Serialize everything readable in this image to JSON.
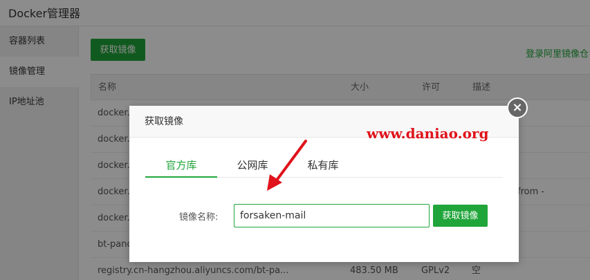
{
  "app": {
    "title": "Docker管理器"
  },
  "sidebar": {
    "items": [
      {
        "label": "容器列表"
      },
      {
        "label": "镜像管理"
      },
      {
        "label": "IP地址池"
      }
    ]
  },
  "toolbar": {
    "fetch_image_label": "获取镜像",
    "aliyun_login_link": "登录阿里镜像仓"
  },
  "table": {
    "headers": {
      "name": "名称",
      "size": "大小",
      "license": "许可",
      "desc": "描述"
    },
    "rows": [
      {
        "name": "docker.",
        "size": "",
        "license": "",
        "desc": ""
      },
      {
        "name": "docker.",
        "size": "",
        "license": "",
        "desc": ""
      },
      {
        "name": "docker.",
        "size": "",
        "license": "",
        "desc": ""
      },
      {
        "name": "docker.",
        "size": "",
        "license": "",
        "desc": "from -"
      },
      {
        "name": "docker.",
        "size": "",
        "license": "",
        "desc": ""
      },
      {
        "name": "bt-panc",
        "size": "",
        "license": "",
        "desc": ""
      },
      {
        "name": "registry.cn-hangzhou.aliyuncs.com/bt-pa...",
        "size": "483.50 MB",
        "license": "GPLv2",
        "desc": "空"
      }
    ]
  },
  "dialog": {
    "title": "获取镜像",
    "close_symbol": "×",
    "tabs": [
      {
        "label": "官方库"
      },
      {
        "label": "公网库"
      },
      {
        "label": "私有库"
      }
    ],
    "field_label": "镜像名称:",
    "input_value": "forsaken-mail",
    "submit_label": "获取镜像"
  },
  "watermark": {
    "text": "www.daniao.org"
  },
  "colors": {
    "accent": "#20a53a",
    "watermark": "#e0121a",
    "arrow": "#e0121a"
  }
}
